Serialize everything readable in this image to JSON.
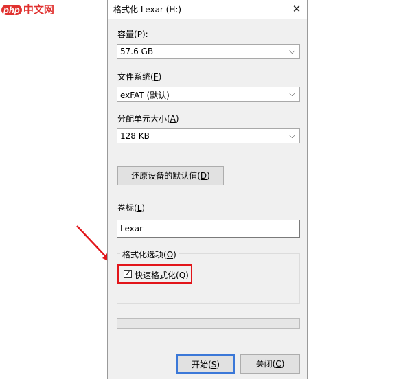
{
  "watermark": {
    "php": "php",
    "site": "中文网"
  },
  "dialog": {
    "title": "格式化 Lexar (H:)",
    "capacity": {
      "label": "容量(",
      "key": "P",
      "suffix": "):",
      "value": "57.6 GB"
    },
    "filesystem": {
      "label": "文件系统(",
      "key": "F",
      "suffix": ")",
      "value": "exFAT (默认)"
    },
    "alloc": {
      "label": "分配单元大小(",
      "key": "A",
      "suffix": ")",
      "value": "128 KB"
    },
    "restore_button": {
      "label": "还原设备的默认值(",
      "key": "D",
      "suffix": ")"
    },
    "volume": {
      "label": "卷标(",
      "key": "L",
      "suffix": ")",
      "value": "Lexar"
    },
    "options": {
      "label": "格式化选项(",
      "key": "O",
      "suffix": ")",
      "quick_format": {
        "label": "快速格式化(",
        "key": "Q",
        "suffix": ")",
        "checked": true,
        "check_glyph": "✓"
      }
    },
    "progress": {
      "fraction": 0
    },
    "start_button": {
      "label": "开始(",
      "key": "S",
      "suffix": ")"
    },
    "close_button": {
      "label": "关闭(",
      "key": "C",
      "suffix": ")"
    }
  },
  "icons": {
    "close": "✕",
    "chevron": "⌵"
  },
  "colors": {
    "highlight": "#e2151a",
    "arrow": "#e2151a"
  }
}
